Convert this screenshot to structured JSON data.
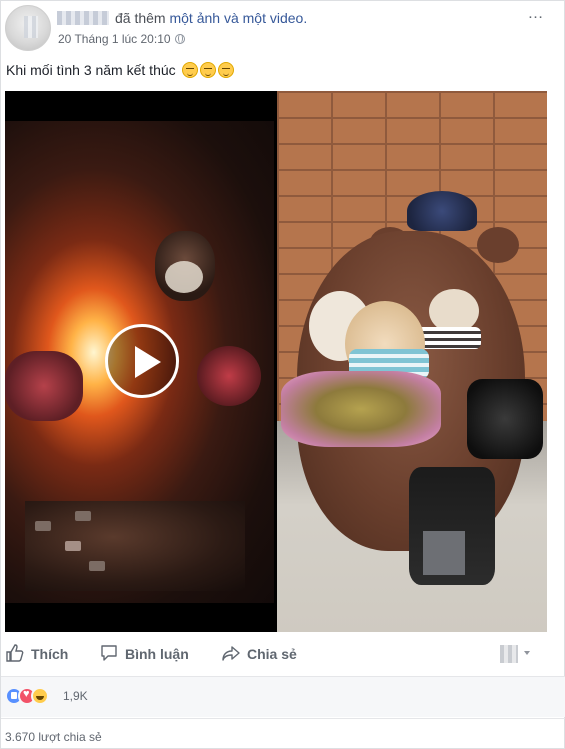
{
  "post": {
    "author_action": "đã thêm",
    "author_action_link": "một ảnh và một video.",
    "timestamp": "20 Tháng 1 lúc 20:10",
    "privacy_icon": "globe-icon",
    "more_icon": "more-options-icon",
    "text": "Khi mối tình 3 năm kết thúc",
    "emojis": [
      "pensive-emoji",
      "pensive-emoji",
      "pensive-emoji"
    ]
  },
  "media": {
    "video_play_icon": "play-icon"
  },
  "actions": {
    "like_label": "Thích",
    "comment_label": "Bình luận",
    "share_label": "Chia sẻ"
  },
  "reactions": {
    "types": [
      "like",
      "love",
      "haha"
    ],
    "count": "1,9K"
  },
  "shares": {
    "count_text": "3.670 lượt chia sẻ"
  },
  "colors": {
    "link": "#365899",
    "meta": "#616770",
    "like": "#5890ff",
    "love": "#f25268",
    "haha": "#ffcc4d"
  }
}
